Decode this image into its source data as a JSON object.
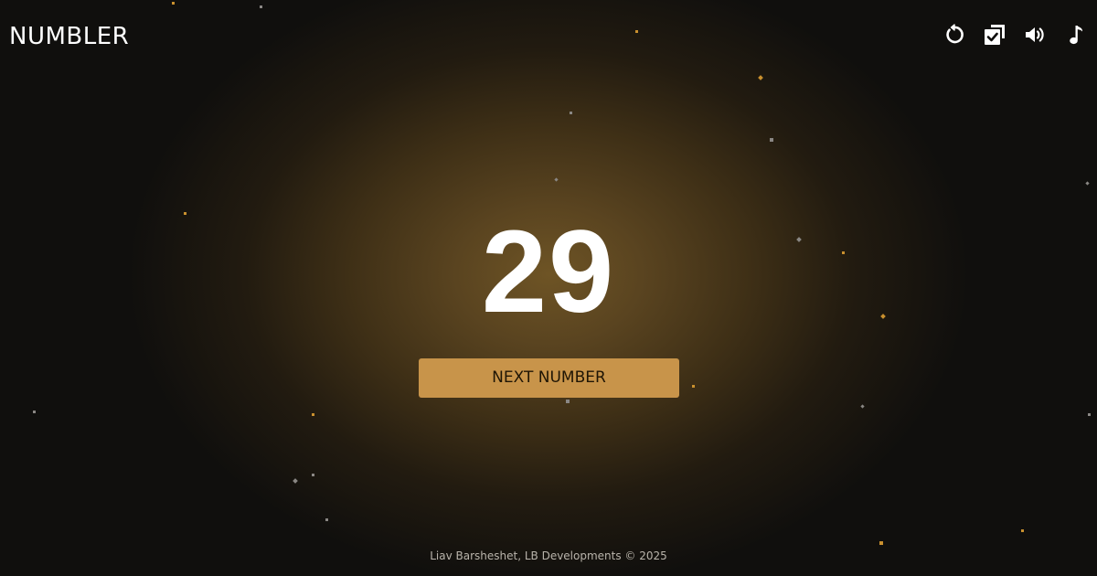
{
  "app": {
    "title": "NUMBLER"
  },
  "toolbar": {
    "items": [
      {
        "icon": "refresh-icon",
        "label": "Reset"
      },
      {
        "icon": "checklist-icon",
        "label": "History"
      },
      {
        "icon": "volume-icon",
        "label": "Sound"
      },
      {
        "icon": "music-note-icon",
        "label": "Music"
      }
    ]
  },
  "main": {
    "current_number": "29",
    "next_button_label": "NEXT NUMBER"
  },
  "footer": {
    "text": "Liav Barsheshet, LB Developments © 2025"
  },
  "colors": {
    "background": "#0e0d0c",
    "glow": "#6e5425",
    "accent": "#c8944a",
    "text": "#ffffff"
  }
}
